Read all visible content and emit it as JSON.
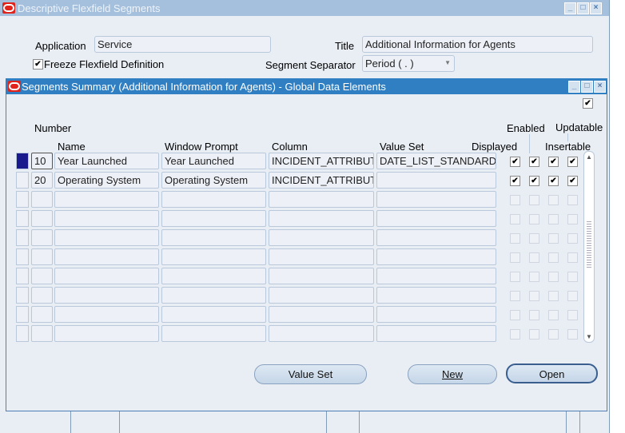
{
  "outer_window": {
    "title": "Descriptive Flexfield Segments",
    "application_label": "Application",
    "application_value": "Service",
    "title_label": "Title",
    "title_value": "Additional Information for Agents",
    "freeze_label": "Freeze Flexfield Definition",
    "freeze_checked": true,
    "separator_label": "Segment Separator",
    "separator_value": "Period ( . )"
  },
  "inner_window": {
    "title": "Segments Summary (Additional Information for Agents) - Global Data Elements",
    "top_checkbox_checked": true,
    "headers": {
      "number": "Number",
      "name": "Name",
      "prompt": "Window Prompt",
      "column": "Column",
      "value_set": "Value Set",
      "displayed": "Displayed",
      "enabled": "Enabled",
      "insertable": "Insertable",
      "updatable": "Updatable"
    },
    "rows": [
      {
        "number": "10",
        "name": "Year Launched",
        "prompt": "Year Launched",
        "column": "INCIDENT_ATTRIBUTE_",
        "value_set": "DATE_LIST_STANDARD",
        "checks": [
          true,
          true,
          true,
          true
        ]
      },
      {
        "number": "20",
        "name": "Operating System",
        "prompt": "Operating System",
        "column": "INCIDENT_ATTRIBUTE_",
        "value_set": "",
        "checks": [
          true,
          true,
          true,
          true
        ]
      },
      {},
      {},
      {},
      {},
      {},
      {},
      {},
      {}
    ],
    "buttons": {
      "value_set": "Value Set",
      "new": "New",
      "open": "Open"
    }
  }
}
